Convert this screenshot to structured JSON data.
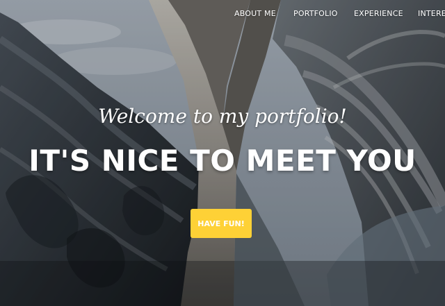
{
  "navigation": {
    "items": [
      {
        "label": "ABOUT ME"
      },
      {
        "label": "PORTFOLIO"
      },
      {
        "label": "EXPERIENCE"
      },
      {
        "label": "INTERES"
      }
    ]
  },
  "hero": {
    "subtitle": "Welcome to my portfolio!",
    "headline": "IT'S NICE TO MEET YOU",
    "button_label": "HAVE FUN!"
  },
  "colors": {
    "accent": "#fed136",
    "text": "#ffffff",
    "sky": "#8f9aa6"
  }
}
